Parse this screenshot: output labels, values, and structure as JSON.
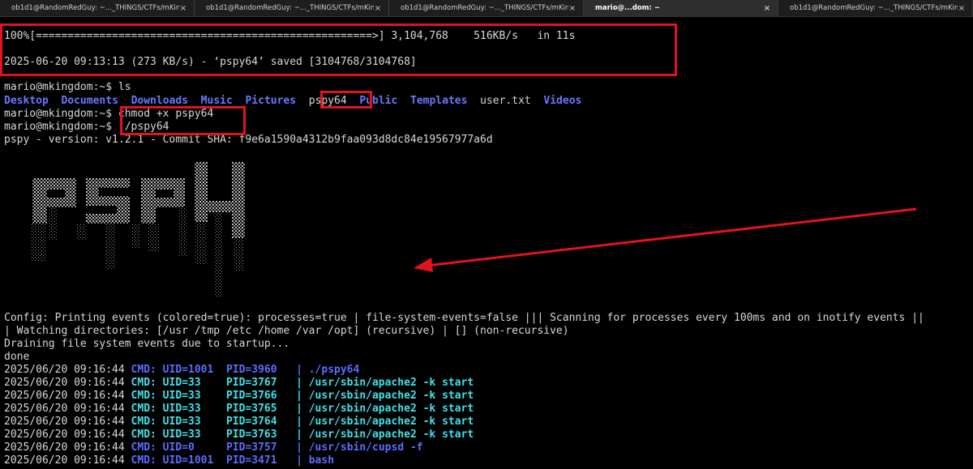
{
  "tabs": [
    {
      "label": "ob1d1@RandomRedGuy: ~..._THINGS/CTFs/mKingdom",
      "active": false
    },
    {
      "label": "ob1d1@RandomRedGuy: ~..._THINGS/CTFs/mKingdom",
      "active": false
    },
    {
      "label": "ob1d1@RandomRedGuy: ~..._THINGS/CTFs/mKingdom",
      "active": false
    },
    {
      "label": "mario@...dom: ~",
      "active": true
    },
    {
      "label": "ob1d1@RandomRedGuy: ~..._THINGS/CTFs/mKingdom",
      "active": false
    }
  ],
  "close_glyph": "×",
  "download": {
    "progress_line": "100%[=====================================================>] 3,104,768    516KB/s   in 11s",
    "saved_line": "2025-06-20 09:13:13 (273 KB/s) - ‘pspy64’ saved [3104768/3104768]"
  },
  "prompt": "mario@mkingdom:~$",
  "commands": {
    "ls": "ls",
    "chmod": "chmod +x pspy64",
    "run": "./pspy64"
  },
  "ls_entries": {
    "desktop": "Desktop",
    "documents": "Documents",
    "downloads": "Downloads",
    "music": "Music",
    "pictures": "Pictures",
    "pspy64": "pspy64",
    "public": "Public",
    "templates": "Templates",
    "user_txt": "user.txt",
    "videos": "Videos"
  },
  "version_line": "pspy - version: v1.2.1 - Commit SHA: f9e6a1590a4312b9faa093d8dc84e19567977a6d",
  "banner_text": "pspy",
  "config_lines": [
    "Config: Printing events (colored=true): processes=true | file-system-events=false ||| Scanning for processes every 100ms and on inotify events ||",
    "| Watching directories: [/usr /tmp /etc /home /var /opt] (recursive) | [] (non-recursive)",
    "Draining file system events due to startup...",
    "done"
  ],
  "events": [
    {
      "time": "2025/06/20 09:16:44",
      "cmd": "CMD: UID=1001",
      "pid": "PID=3960",
      "sep": "|",
      "proc": "./pspy64"
    },
    {
      "time": "2025/06/20 09:16:44",
      "cmd": "CMD: UID=33",
      "pid": "PID=3767",
      "sep": "|",
      "proc": "/usr/sbin/apache2 -k start"
    },
    {
      "time": "2025/06/20 09:16:44",
      "cmd": "CMD: UID=33",
      "pid": "PID=3766",
      "sep": "|",
      "proc": "/usr/sbin/apache2 -k start"
    },
    {
      "time": "2025/06/20 09:16:44",
      "cmd": "CMD: UID=33",
      "pid": "PID=3765",
      "sep": "|",
      "proc": "/usr/sbin/apache2 -k start"
    },
    {
      "time": "2025/06/20 09:16:44",
      "cmd": "CMD: UID=33",
      "pid": "PID=3764",
      "sep": "|",
      "proc": "/usr/sbin/apache2 -k start"
    },
    {
      "time": "2025/06/20 09:16:44",
      "cmd": "CMD: UID=33",
      "pid": "PID=3763",
      "sep": "|",
      "proc": "/usr/sbin/apache2 -k start"
    },
    {
      "time": "2025/06/20 09:16:44",
      "cmd": "CMD: UID=0",
      "pid": "PID=3757",
      "sep": "|",
      "proc": "/usr/sbin/cupsd -f"
    },
    {
      "time": "2025/06/20 09:16:44",
      "cmd": "CMD: UID=1001",
      "pid": "PID=3471",
      "sep": "|",
      "proc": "bash"
    }
  ],
  "colors": {
    "annotation_red": "#e0141c",
    "ls_dir_blue": "#6a78ff",
    "uid_blue": "#5c6cff",
    "apache_cyan": "#3fe0e8"
  }
}
